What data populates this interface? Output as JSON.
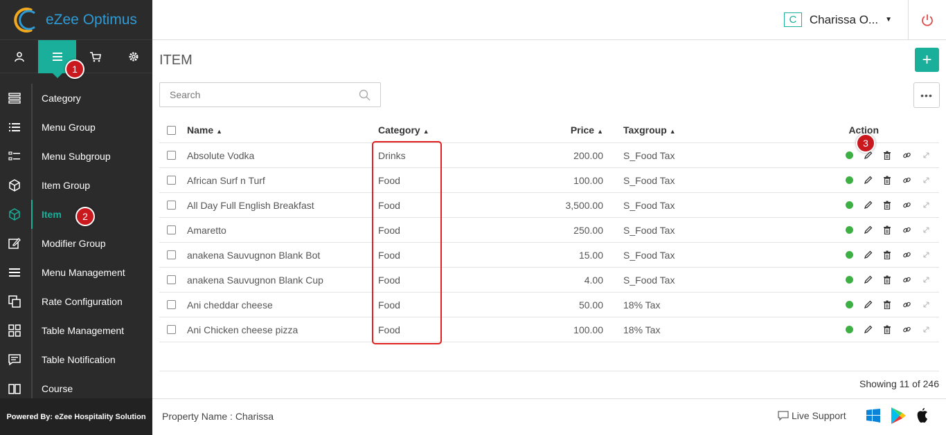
{
  "app": {
    "name": "eZee Optimus",
    "powered_by": "Powered By: eZee Hospitality Solution"
  },
  "header": {
    "user_initial": "C",
    "user_name": "Charissa O..."
  },
  "top_icons": [
    "user-icon",
    "menu-icon",
    "cart-icon",
    "gear-icon"
  ],
  "sidebar": {
    "items": [
      {
        "label": "Category",
        "icon": "list-stack-icon"
      },
      {
        "label": "Menu Group",
        "icon": "bullet-list-icon"
      },
      {
        "label": "Menu Subgroup",
        "icon": "sublist-icon"
      },
      {
        "label": "Item Group",
        "icon": "cube-icon"
      },
      {
        "label": "Item",
        "icon": "cube-icon",
        "active": true
      },
      {
        "label": "Modifier Group",
        "icon": "edit-icon"
      },
      {
        "label": "Menu Management",
        "icon": "hamburger-icon"
      },
      {
        "label": "Rate Configuration",
        "icon": "copy-icon"
      },
      {
        "label": "Table Management",
        "icon": "grid-icon"
      },
      {
        "label": "Table Notification",
        "icon": "message-icon"
      },
      {
        "label": "Course",
        "icon": "book-icon"
      }
    ]
  },
  "annotations": {
    "badge1": "1",
    "badge2": "2",
    "badge3": "3"
  },
  "page": {
    "title": "ITEM",
    "add_label": "+",
    "more_label": "•••"
  },
  "search": {
    "placeholder": "Search"
  },
  "table": {
    "headers": {
      "name": "Name",
      "category": "Category",
      "price": "Price",
      "taxgroup": "Taxgroup",
      "action": "Action"
    },
    "rows": [
      {
        "name": "Absolute Vodka",
        "category": "Drinks",
        "price": "200.00",
        "taxgroup": "S_Food Tax"
      },
      {
        "name": "African Surf n Turf",
        "category": "Food",
        "price": "100.00",
        "taxgroup": "S_Food Tax"
      },
      {
        "name": "All Day Full English Breakfast",
        "category": "Food",
        "price": "3,500.00",
        "taxgroup": "S_Food Tax"
      },
      {
        "name": "Amaretto",
        "category": "Food",
        "price": "250.00",
        "taxgroup": "S_Food Tax"
      },
      {
        "name": "anakena Sauvugnon Blank Bot",
        "category": "Food",
        "price": "15.00",
        "taxgroup": "S_Food Tax"
      },
      {
        "name": "anakena Sauvugnon Blank Cup",
        "category": "Food",
        "price": "4.00",
        "taxgroup": "S_Food Tax"
      },
      {
        "name": "Ani cheddar cheese",
        "category": "Food",
        "price": "50.00",
        "taxgroup": "18% Tax"
      },
      {
        "name": "Ani Chicken cheese pizza",
        "category": "Food",
        "price": "100.00",
        "taxgroup": "18% Tax"
      }
    ],
    "status_color": "#3cb043",
    "showing": "Showing 11 of 246"
  },
  "footer": {
    "property": "Property Name : Charissa",
    "live_support": "Live Support"
  },
  "colors": {
    "accent": "#1aaf9b",
    "sidebar_bg": "#2b2b2b",
    "highlight": "#e02020"
  }
}
